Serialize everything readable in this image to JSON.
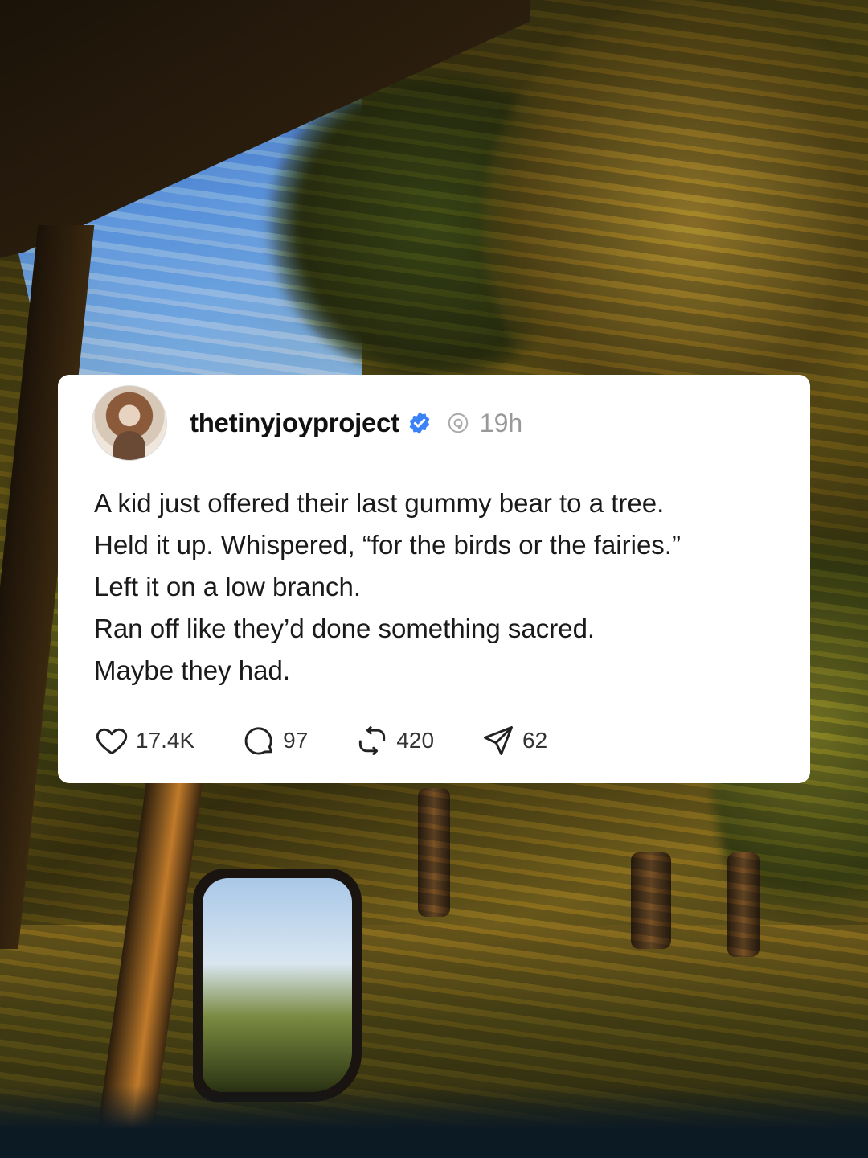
{
  "post": {
    "username": "thetinyjoyproject",
    "timestamp": "19h",
    "lines": [
      "A kid just offered their last gummy bear to a tree.",
      "Held it up. Whispered, “for the birds or the fairies.”",
      "Left it on a low branch.",
      "Ran off like they’d done something sacred.",
      "Maybe they had."
    ],
    "stats": {
      "likes": "17.4K",
      "replies": "97",
      "reposts": "420",
      "shares": "62"
    }
  },
  "colors": {
    "verified": "#3b82f6",
    "text": "#1a1a1a",
    "muted": "#999999"
  },
  "icons": [
    "verified-badge-icon",
    "threads-icon",
    "heart-icon",
    "comment-icon",
    "repost-icon",
    "share-icon"
  ]
}
